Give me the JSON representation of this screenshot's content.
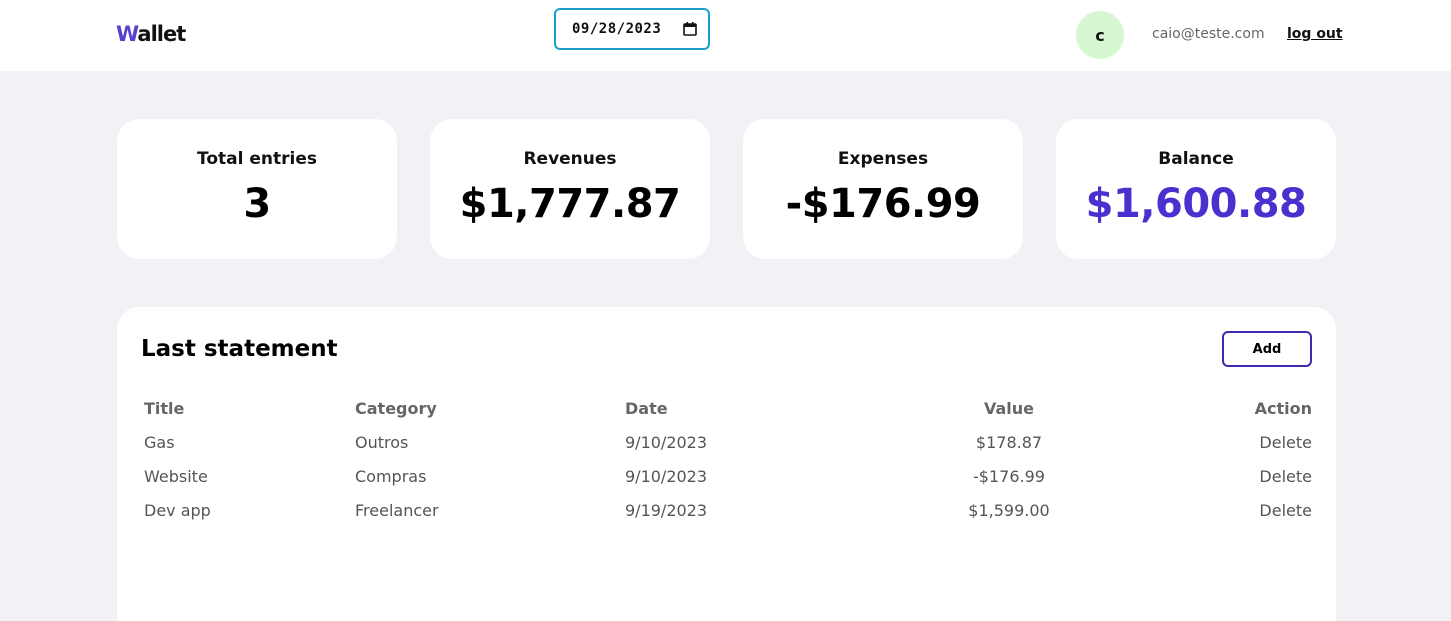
{
  "header": {
    "logo_first": "W",
    "logo_rest": "allet",
    "date_value": "09/28/2023",
    "avatar_initial": "c",
    "user_email": "caio@teste.com",
    "logout_label": "log out"
  },
  "summary": [
    {
      "label": "Total entries",
      "value": "3"
    },
    {
      "label": "Revenues",
      "value": "$1,777.87"
    },
    {
      "label": "Expenses",
      "value": "-$176.99"
    },
    {
      "label": "Balance",
      "value": "$1,600.88"
    }
  ],
  "statement": {
    "title": "Last statement",
    "add_label": "Add",
    "columns": [
      "Title",
      "Category",
      "Date",
      "Value",
      "Action"
    ],
    "rows": [
      {
        "title": "Gas",
        "category": "Outros",
        "date": "9/10/2023",
        "value": "$178.87",
        "action": "Delete"
      },
      {
        "title": "Website",
        "category": "Compras",
        "date": "9/10/2023",
        "value": "-$176.99",
        "action": "Delete"
      },
      {
        "title": "Dev app",
        "category": "Freelancer",
        "date": "9/19/2023",
        "value": "$1,599.00",
        "action": "Delete"
      }
    ]
  },
  "colors": {
    "accent": "#4b2fcf",
    "date_border": "#1ba0c9",
    "avatar_bg": "#d7f7d3",
    "page_bg": "#f1f1f6"
  },
  "icons": {
    "date_picker": "calendar-icon"
  }
}
